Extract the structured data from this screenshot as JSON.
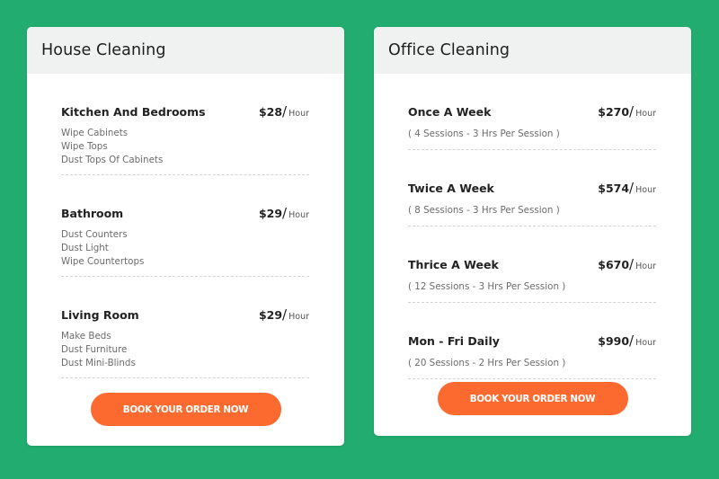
{
  "colors": {
    "background": "#22ac6f",
    "card": "#ffffff",
    "header": "#f0f2f1",
    "button": "#fd6a30"
  },
  "house": {
    "title": "House Cleaning",
    "items": [
      {
        "name": "Kitchen And Bedrooms",
        "price": "$28",
        "slash": "/",
        "unit": "Hour",
        "tasks": [
          "Wipe Cabinets",
          "Wipe Tops",
          "Dust Tops Of Cabinets"
        ]
      },
      {
        "name": "Bathroom",
        "price": "$29",
        "slash": "/",
        "unit": "Hour",
        "tasks": [
          "Dust Counters",
          "Dust Light",
          "Wipe Countertops"
        ]
      },
      {
        "name": "Living Room",
        "price": "$29",
        "slash": "/",
        "unit": "Hour",
        "tasks": [
          "Make Beds",
          "Dust Furniture",
          "Dust Mini-Blinds"
        ]
      }
    ],
    "button_label": "BOOK YOUR ORDER NOW"
  },
  "office": {
    "title": "Office Cleaning",
    "items": [
      {
        "name": "Once A Week",
        "price": "$270",
        "slash": "/",
        "unit": "Hour",
        "detail": "( 4 Sessions - 3 Hrs Per Session )"
      },
      {
        "name": "Twice A Week",
        "price": "$574",
        "slash": "/",
        "unit": "Hour",
        "detail": "( 8 Sessions - 3 Hrs Per Session )"
      },
      {
        "name": "Thrice A Week",
        "price": "$670",
        "slash": "/",
        "unit": "Hour",
        "detail": "( 12 Sessions - 3 Hrs Per Session )"
      },
      {
        "name": "Mon - Fri Daily",
        "price": "$990",
        "slash": "/",
        "unit": "Hour",
        "detail": "( 20 Sessions - 2 Hrs Per Session )"
      }
    ],
    "button_label": "BOOK YOUR ORDER NOW"
  }
}
